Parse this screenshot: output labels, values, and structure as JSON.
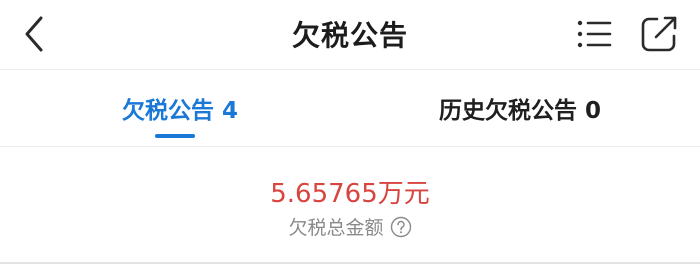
{
  "header": {
    "title": "欠税公告",
    "back_icon": "chevron-left-icon",
    "list_icon": "list-icon",
    "share_icon": "share-external-icon"
  },
  "tabs": [
    {
      "label": "欠税公告 4",
      "active": true
    },
    {
      "label": "历史欠税公告 0",
      "active": false
    }
  ],
  "summary": {
    "amount": "5.65765万元",
    "label": "欠税总金额",
    "help_icon": "question-circle-icon"
  },
  "colors": {
    "accent": "#1a78d6",
    "amount": "#d8443f",
    "muted": "#8a8a8a"
  }
}
